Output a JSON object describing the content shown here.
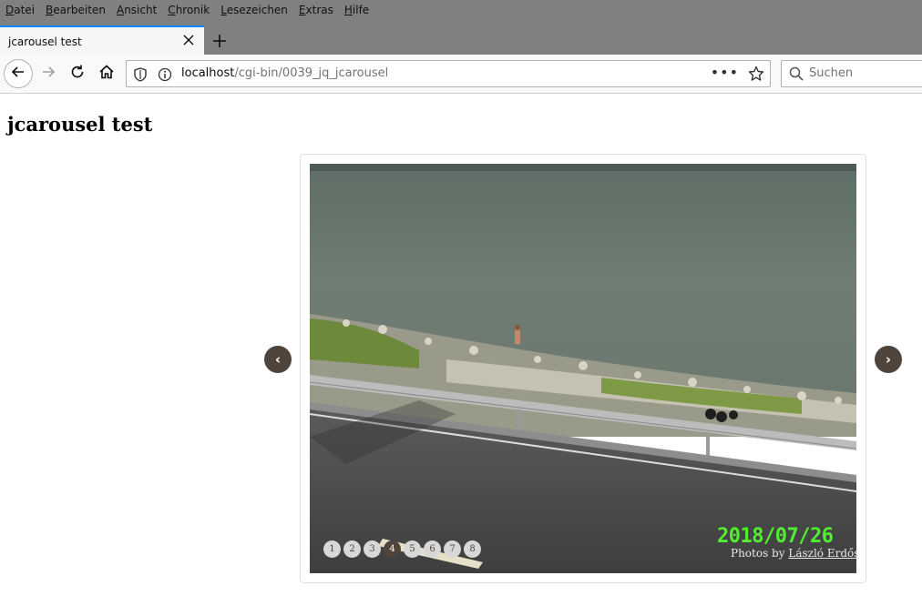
{
  "menu": {
    "items": [
      {
        "underline": "D",
        "rest": "atei"
      },
      {
        "underline": "B",
        "rest": "earbeiten"
      },
      {
        "underline": "A",
        "rest": "nsicht"
      },
      {
        "underline": "C",
        "rest": "hronik"
      },
      {
        "underline": "L",
        "rest": "esezeichen"
      },
      {
        "underline": "E",
        "rest": "xtras"
      },
      {
        "underline": "H",
        "rest": "ilfe"
      }
    ]
  },
  "tab": {
    "title": "jcarousel test"
  },
  "urlbar": {
    "host": "localhost",
    "path": "/cgi-bin/0039_jq_jcarousel",
    "dots": "•••"
  },
  "search": {
    "placeholder": "Suchen"
  },
  "page": {
    "title": "jcarousel test"
  },
  "carousel": {
    "prev_label": "‹",
    "next_label": "›",
    "pages": [
      "1",
      "2",
      "3",
      "4",
      "5",
      "6",
      "7",
      "8"
    ],
    "active_page": "4",
    "date_stamp": "2018/07/26",
    "credit_prefix": "Photos by",
    "credit_name": "László Erdős"
  },
  "colors": {
    "accent": "#0a84ff",
    "arrow_bg": "#4e443c",
    "date_stamp": "#52ee30"
  },
  "icons": [
    "back-arrow-icon",
    "forward-arrow-icon",
    "reload-icon",
    "home-icon",
    "shield-icon",
    "info-icon",
    "star-icon",
    "search-icon",
    "close-icon",
    "plus-icon"
  ]
}
